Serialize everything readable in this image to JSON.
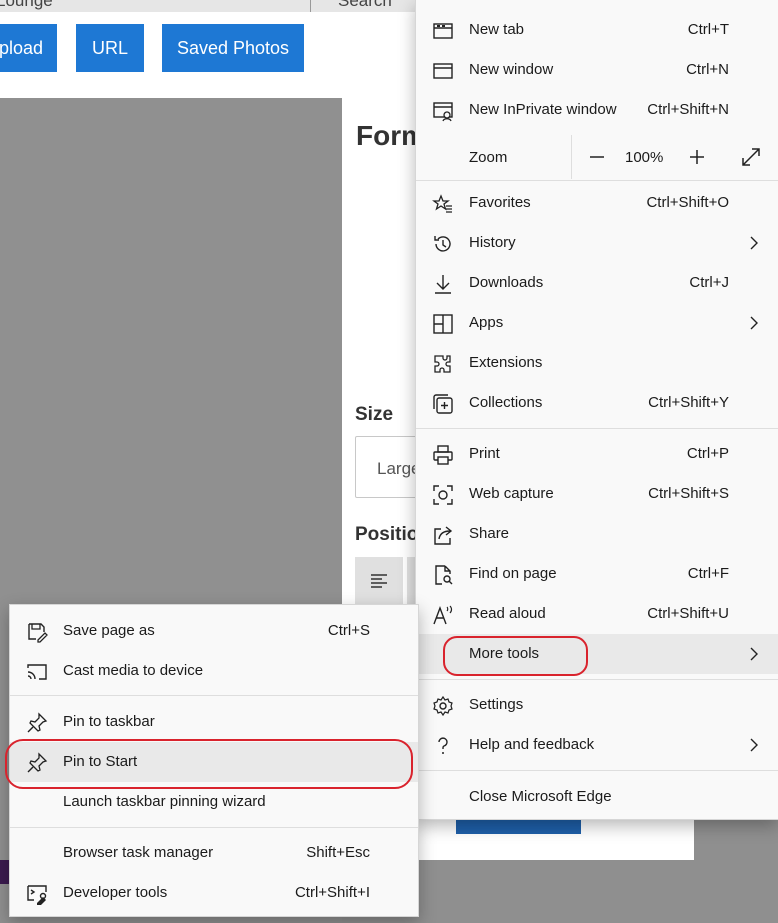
{
  "background_page": {
    "top_strip": {
      "left_text": "Lounge",
      "right_text": "Search"
    },
    "toolbar": {
      "buttons": [
        "Upload",
        "URL",
        "Saved Photos"
      ]
    },
    "form": {
      "heading": "Form",
      "size_label": "Size",
      "size_value": "Large",
      "position_label": "Positio"
    }
  },
  "main_menu": {
    "items": [
      {
        "label": "New tab",
        "shortcut": "Ctrl+T",
        "icon": "new-tab-icon"
      },
      {
        "label": "New window",
        "shortcut": "Ctrl+N",
        "icon": "new-window-icon"
      },
      {
        "label": "New InPrivate window",
        "shortcut": "Ctrl+Shift+N",
        "icon": "inprivate-icon"
      }
    ],
    "zoom": {
      "label": "Zoom",
      "value": "100%",
      "minus": "−",
      "plus": "+"
    },
    "items2": [
      {
        "label": "Favorites",
        "shortcut": "Ctrl+Shift+O",
        "icon": "favorites-icon"
      },
      {
        "label": "History",
        "shortcut": "",
        "icon": "history-icon"
      },
      {
        "label": "Downloads",
        "shortcut": "Ctrl+J",
        "icon": "downloads-icon"
      },
      {
        "label": "Apps",
        "shortcut": "",
        "icon": "apps-icon"
      },
      {
        "label": "Extensions",
        "shortcut": "",
        "icon": "extensions-icon"
      },
      {
        "label": "Collections",
        "shortcut": "Ctrl+Shift+Y",
        "icon": "collections-icon"
      }
    ],
    "items3": [
      {
        "label": "Print",
        "shortcut": "Ctrl+P",
        "icon": "print-icon"
      },
      {
        "label": "Web capture",
        "shortcut": "Ctrl+Shift+S",
        "icon": "web-capture-icon"
      },
      {
        "label": "Share",
        "shortcut": "",
        "icon": "share-icon"
      },
      {
        "label": "Find on page",
        "shortcut": "Ctrl+F",
        "icon": "find-icon"
      },
      {
        "label": "Read aloud",
        "shortcut": "Ctrl+Shift+U",
        "icon": "read-aloud-icon"
      },
      {
        "label": "More tools",
        "shortcut": "",
        "icon": ""
      }
    ],
    "items4": [
      {
        "label": "Settings",
        "icon": "settings-icon"
      },
      {
        "label": "Help and feedback",
        "icon": "help-icon"
      }
    ],
    "close_label": "Close Microsoft Edge"
  },
  "sub_menu": {
    "items": [
      {
        "label": "Save page as",
        "shortcut": "Ctrl+S",
        "icon": "save-page-icon"
      },
      {
        "label": "Cast media to device",
        "shortcut": "",
        "icon": "cast-icon"
      },
      {
        "label": "Pin to taskbar",
        "shortcut": "",
        "icon": "pin-icon"
      },
      {
        "label": "Pin to Start",
        "shortcut": "",
        "icon": "pin-icon"
      },
      {
        "label": "Launch taskbar pinning wizard",
        "shortcut": "",
        "icon": ""
      },
      {
        "label": "Browser task manager",
        "shortcut": "Shift+Esc",
        "icon": ""
      },
      {
        "label": "Developer tools",
        "shortcut": "Ctrl+Shift+I",
        "icon": "developer-tools-icon"
      }
    ]
  },
  "colors": {
    "accent": "#1e78d4",
    "highlight_ring": "#d9232d",
    "menu_bg": "#f9f9f9"
  }
}
